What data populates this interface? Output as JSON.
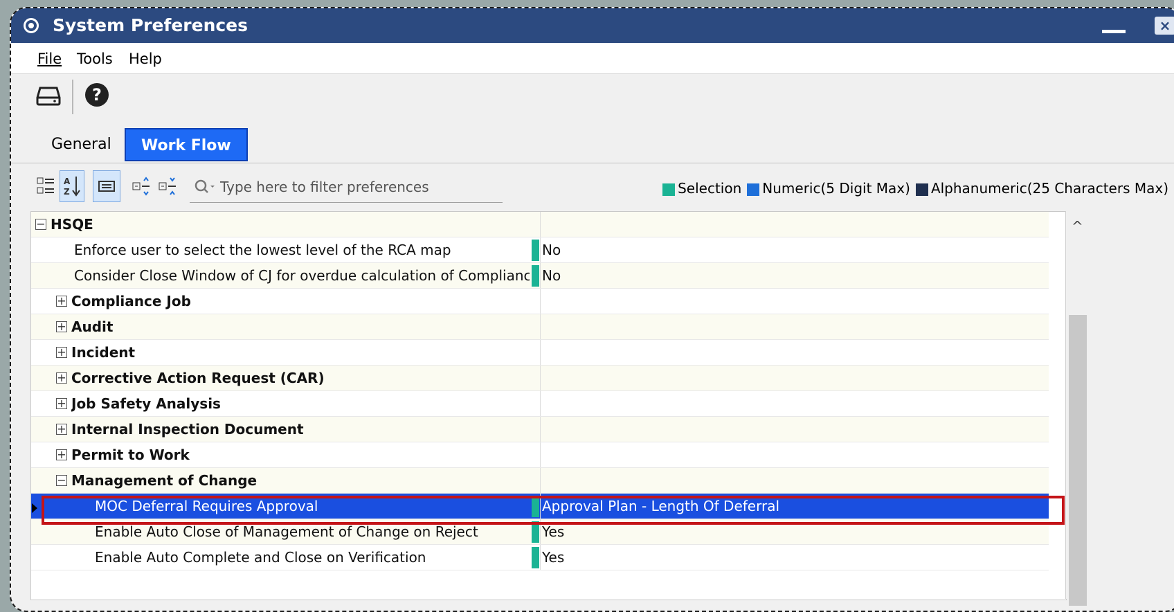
{
  "window": {
    "title": "System Preferences"
  },
  "menu": {
    "file": "File",
    "tools": "Tools",
    "help": "Help"
  },
  "toolbar": {
    "icons": [
      "drive-icon",
      "help-icon"
    ]
  },
  "tabs": [
    {
      "label": "General",
      "active": false
    },
    {
      "label": "Work Flow",
      "active": true
    }
  ],
  "filter": {
    "placeholder": "Type here to filter preferences"
  },
  "legend": {
    "items": [
      {
        "label": "Selection",
        "color": "#1ab394"
      },
      {
        "label": "Numeric(5 Digit Max)",
        "color": "#1e6fd9"
      },
      {
        "label": "Alphanumeric(25 Characters Max)",
        "color": "#1f2f4f"
      }
    ]
  },
  "grid": {
    "rows": [
      {
        "kind": "group",
        "label": "HSQE",
        "expanded": true,
        "level": 0,
        "value": ""
      },
      {
        "kind": "pref",
        "label": "Enforce user to select the lowest level of the RCA map",
        "value": "No",
        "level": 1
      },
      {
        "kind": "pref",
        "label": "Consider Close Window of CJ for overdue calculation of Complianc...",
        "value": "No",
        "level": 1
      },
      {
        "kind": "group",
        "label": "Compliance Job",
        "expanded": false,
        "level": 1,
        "value": ""
      },
      {
        "kind": "group",
        "label": "Audit",
        "expanded": false,
        "level": 1,
        "value": ""
      },
      {
        "kind": "group",
        "label": "Incident",
        "expanded": false,
        "level": 1,
        "value": ""
      },
      {
        "kind": "group",
        "label": "Corrective Action Request (CAR)",
        "expanded": false,
        "level": 1,
        "value": ""
      },
      {
        "kind": "group",
        "label": "Job Safety Analysis",
        "expanded": false,
        "level": 1,
        "value": ""
      },
      {
        "kind": "group",
        "label": "Internal Inspection Document",
        "expanded": false,
        "level": 1,
        "value": ""
      },
      {
        "kind": "group",
        "label": "Permit to Work",
        "expanded": false,
        "level": 1,
        "value": ""
      },
      {
        "kind": "group",
        "label": "Management of Change",
        "expanded": true,
        "level": 1,
        "value": ""
      },
      {
        "kind": "pref",
        "label": "MOC Deferral Requires Approval",
        "value": "Approval Plan - Length Of Deferral",
        "level": 2,
        "selected": true
      },
      {
        "kind": "pref",
        "label": "Enable Auto Close of Management of Change on Reject",
        "value": "Yes",
        "level": 2
      },
      {
        "kind": "pref",
        "label": "Enable Auto Complete and Close on Verification",
        "value": "Yes",
        "level": 2
      }
    ]
  }
}
